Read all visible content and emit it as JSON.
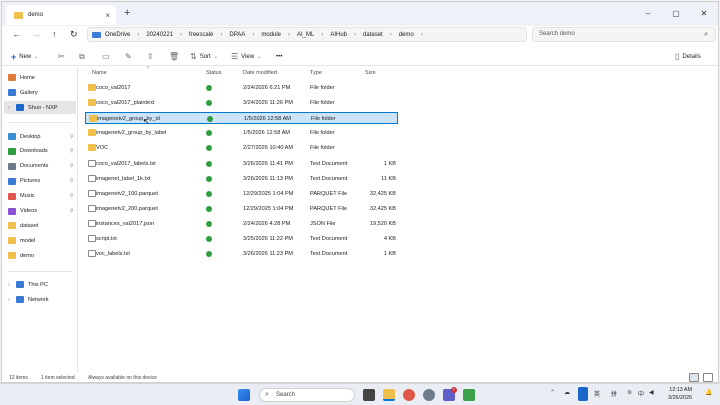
{
  "window": {
    "tab_title": "demo",
    "tab_close": "×",
    "new_tab": "+",
    "controls": [
      "–",
      "▢",
      "✕"
    ]
  },
  "address": {
    "back": "←",
    "forward": "→",
    "up": "↑",
    "refresh": "↻",
    "breadcrumb": [
      "OneDrive",
      "20240221",
      "freescale",
      "DPAA",
      "module",
      "AI_ML",
      "AIHub",
      "dataset",
      "demo"
    ],
    "search_placeholder": "Search demo"
  },
  "commandbar": {
    "new": "New",
    "sort": "Sort",
    "view": "View",
    "more": "•••",
    "details": "Details"
  },
  "sidebar": {
    "top": [
      {
        "label": "Home",
        "icon": "home-icon",
        "color": "#e07b39"
      },
      {
        "label": "Gallery",
        "icon": "gallery-icon",
        "color": "#3a7bd5"
      },
      {
        "label": "Shuo - NXP",
        "icon": "cloud-icon",
        "color": "#1a66c9"
      }
    ],
    "pinned": [
      {
        "label": "Desktop",
        "icon": "desktop-icon",
        "color": "#3a8fd5"
      },
      {
        "label": "Downloads",
        "icon": "downloads-icon",
        "color": "#2e9e3f"
      },
      {
        "label": "Documents",
        "icon": "documents-icon",
        "color": "#6b7b8c"
      },
      {
        "label": "Pictures",
        "icon": "pictures-icon",
        "color": "#3a7bd5"
      },
      {
        "label": "Music",
        "icon": "music-icon",
        "color": "#e0564a"
      },
      {
        "label": "Videos",
        "icon": "videos-icon",
        "color": "#8a4fd5"
      },
      {
        "label": "dataset",
        "icon": "folder-icon",
        "color": "#f0c04a"
      },
      {
        "label": "model",
        "icon": "folder-icon",
        "color": "#f0c04a"
      },
      {
        "label": "demo",
        "icon": "folder-icon",
        "color": "#f0c04a"
      }
    ],
    "bottom": [
      {
        "label": "This PC",
        "icon": "pc-icon",
        "color": "#3a7bd5"
      },
      {
        "label": "Network",
        "icon": "network-icon",
        "color": "#3a7bd5"
      }
    ]
  },
  "columns": {
    "name": "Name",
    "status": "Status",
    "date": "Date modified",
    "type": "Type",
    "size": "Size"
  },
  "files": [
    {
      "name": "coco_val2017",
      "date": "2/24/2026 6:21 PM",
      "type": "File folder",
      "size": "",
      "kind": "folder"
    },
    {
      "name": "coco_val2017_plaintext",
      "date": "3/24/2026 11:26 PM",
      "type": "File folder",
      "size": "",
      "kind": "folder"
    },
    {
      "name": "imagenetv2_group_by_id",
      "date": "1/5/2026 12:58 AM",
      "type": "File folder",
      "size": "",
      "kind": "folder",
      "selected": true
    },
    {
      "name": "imagenetv2_group_by_label",
      "date": "1/5/2026 12:58 AM",
      "type": "File folder",
      "size": "",
      "kind": "folder"
    },
    {
      "name": "VOC",
      "date": "2/27/2026 10:40 AM",
      "type": "File folder",
      "size": "",
      "kind": "folder"
    },
    {
      "name": "coco_val2017_labels.txt",
      "date": "3/26/2026 11:41 PM",
      "type": "Text Document",
      "size": "1 KB",
      "kind": "doc"
    },
    {
      "name": "imagenet_label_1k.txt",
      "date": "3/26/2026 11:13 PM",
      "type": "Text Document",
      "size": "11 KB",
      "kind": "doc"
    },
    {
      "name": "imagenetv2_100.parquet",
      "date": "12/29/2025 1:04 PM",
      "type": "PARQUET File",
      "size": "32,425 KB",
      "kind": "doc"
    },
    {
      "name": "imagenetv2_200.parquet",
      "date": "12/29/2025 1:04 PM",
      "type": "PARQUET File",
      "size": "32,425 KB",
      "kind": "doc"
    },
    {
      "name": "instances_val2017.json",
      "date": "2/24/2026 4:28 PM",
      "type": "JSON File",
      "size": "19,520 KB",
      "kind": "doc"
    },
    {
      "name": "script.txt",
      "date": "3/25/2026 11:22 PM",
      "type": "Text Document",
      "size": "4 KB",
      "kind": "doc"
    },
    {
      "name": "voc_labels.txt",
      "date": "3/26/2026 11:23 PM",
      "type": "Text Document",
      "size": "1 KB",
      "kind": "doc"
    }
  ],
  "statusbar": {
    "count": "12 items",
    "selected": "1 item selected",
    "availability": "Always available on this device"
  },
  "taskbar": {
    "search": "Search",
    "time": "12:13 AM",
    "date": "3/26/2026",
    "lang1": "英",
    "lang2": "拼",
    "lang3": "中",
    "badge": "7"
  }
}
